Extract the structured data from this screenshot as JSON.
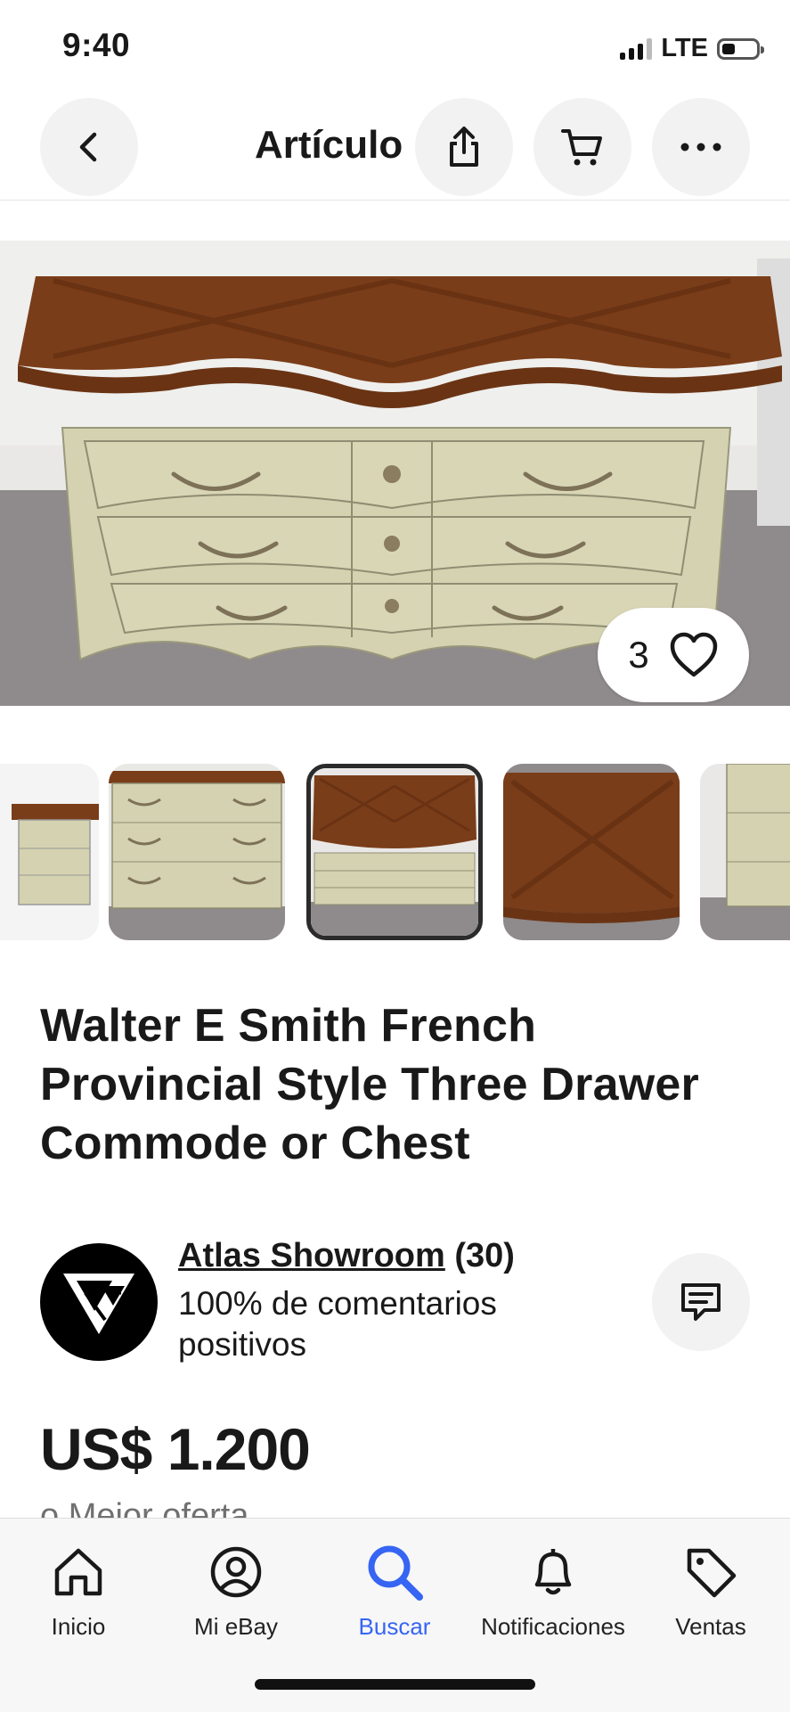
{
  "status_bar": {
    "time": "9:40",
    "network": "LTE",
    "battery_level": 0.35
  },
  "header": {
    "title": "Artículo",
    "icons": [
      "back-arrow-icon",
      "share-icon",
      "cart-icon",
      "more-icon"
    ]
  },
  "hero": {
    "like_count": "3"
  },
  "thumbnails": {
    "count": 5,
    "selected_index": 2
  },
  "item": {
    "title": "Walter E Smith French Provincial Style Three Drawer Commode or Chest"
  },
  "seller": {
    "name": "Atlas Showroom",
    "feedback_count": "(30)",
    "feedback_text": "100% de comentarios positivos"
  },
  "pricing": {
    "price": "US$ 1.200",
    "best_offer": "o Mejor oferta"
  },
  "tabbar": {
    "items": [
      {
        "label": "Inicio",
        "icon": "home-icon"
      },
      {
        "label": "Mi eBay",
        "icon": "profile-icon"
      },
      {
        "label": "Buscar",
        "icon": "search-icon",
        "active": true
      },
      {
        "label": "Notificaciones",
        "icon": "bell-icon"
      },
      {
        "label": "Ventas",
        "icon": "tag-icon"
      }
    ],
    "active_color": "#3665f3"
  },
  "colors": {
    "wood": "#7a3c16",
    "cream": "#d6d3b1",
    "floor": "#8e8a8a"
  }
}
